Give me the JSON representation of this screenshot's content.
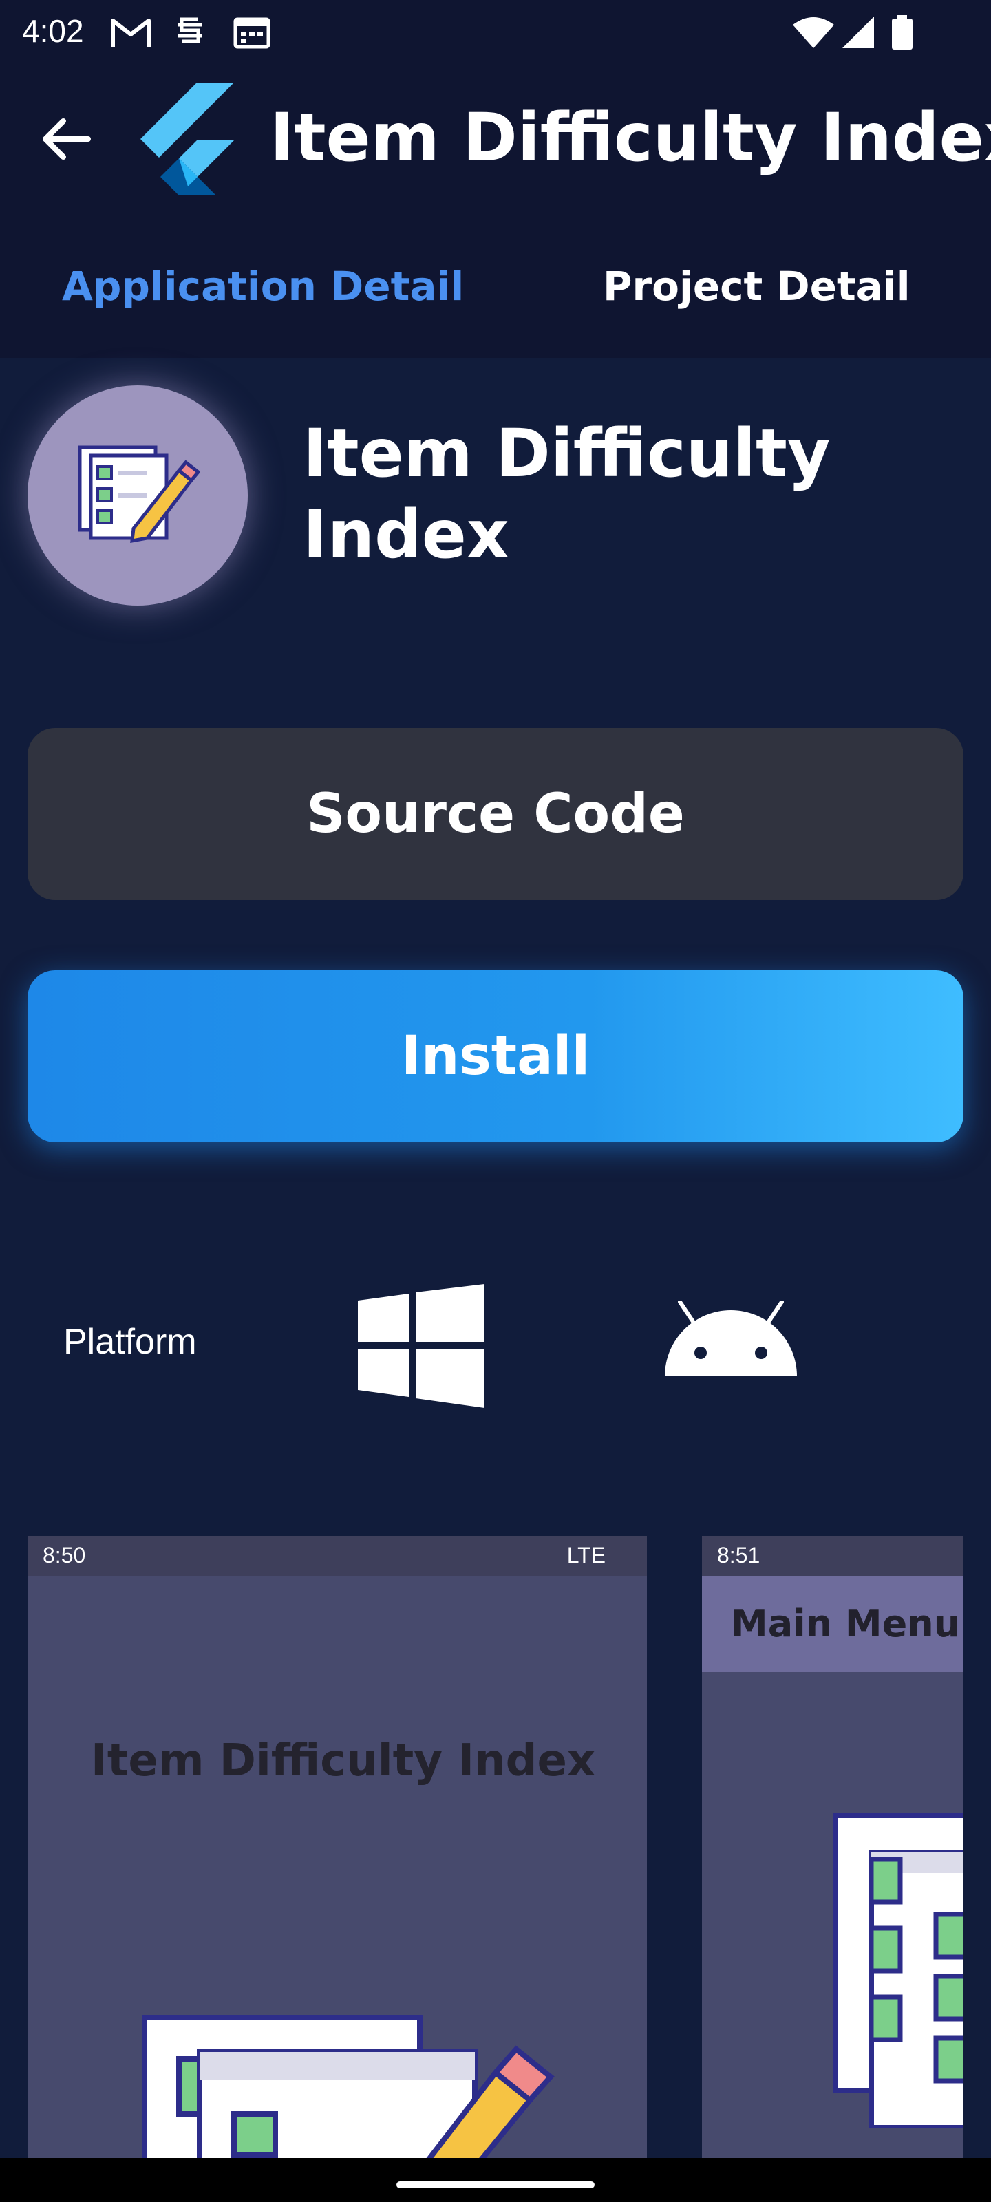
{
  "status_bar": {
    "time": "4:02",
    "left_icons": [
      "gmail-icon",
      "sim-icon",
      "calendar-icon"
    ],
    "right_icons": [
      "wifi-icon",
      "signal-icon",
      "battery-icon"
    ]
  },
  "app_bar": {
    "back_icon": "arrow-back-icon",
    "logo": "flutter-logo",
    "title": "Item Difficulty Index"
  },
  "tabs": [
    {
      "label": "Application Detail",
      "active": true
    },
    {
      "label": "Project Detail",
      "active": false
    }
  ],
  "app": {
    "icon": "checklist-pencil-icon",
    "name": "Item Difficulty Index"
  },
  "buttons": {
    "source_code": "Source Code",
    "install": "Install"
  },
  "platform": {
    "label": "Platform",
    "icons": [
      "windows-icon",
      "android-icon"
    ]
  },
  "screenshots": [
    {
      "status_time": "8:50",
      "status_right": "LTE",
      "title": "Item Difficulty Index"
    },
    {
      "status_time": "8:51",
      "header": "Main Menu"
    }
  ],
  "colors": {
    "background": "#111c3b",
    "app_bar": "#0f1531",
    "tab_active": "#4a90f0",
    "source_button": "#30333f",
    "install_button": "#2298ee"
  }
}
